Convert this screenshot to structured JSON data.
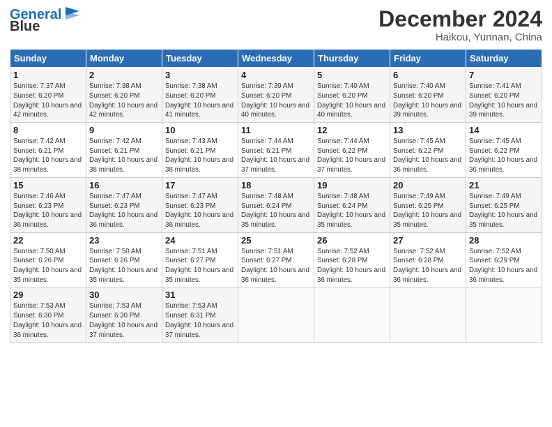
{
  "header": {
    "logo_blue": "General",
    "logo_black": "Blue",
    "month": "December 2024",
    "location": "Haikou, Yunnan, China"
  },
  "days_of_week": [
    "Sunday",
    "Monday",
    "Tuesday",
    "Wednesday",
    "Thursday",
    "Friday",
    "Saturday"
  ],
  "weeks": [
    [
      {
        "day": "1",
        "sunrise": "Sunrise: 7:37 AM",
        "sunset": "Sunset: 6:20 PM",
        "daylight": "Daylight: 10 hours and 42 minutes."
      },
      {
        "day": "2",
        "sunrise": "Sunrise: 7:38 AM",
        "sunset": "Sunset: 6:20 PM",
        "daylight": "Daylight: 10 hours and 42 minutes."
      },
      {
        "day": "3",
        "sunrise": "Sunrise: 7:38 AM",
        "sunset": "Sunset: 6:20 PM",
        "daylight": "Daylight: 10 hours and 41 minutes."
      },
      {
        "day": "4",
        "sunrise": "Sunrise: 7:39 AM",
        "sunset": "Sunset: 6:20 PM",
        "daylight": "Daylight: 10 hours and 40 minutes."
      },
      {
        "day": "5",
        "sunrise": "Sunrise: 7:40 AM",
        "sunset": "Sunset: 6:20 PM",
        "daylight": "Daylight: 10 hours and 40 minutes."
      },
      {
        "day": "6",
        "sunrise": "Sunrise: 7:40 AM",
        "sunset": "Sunset: 6:20 PM",
        "daylight": "Daylight: 10 hours and 39 minutes."
      },
      {
        "day": "7",
        "sunrise": "Sunrise: 7:41 AM",
        "sunset": "Sunset: 6:20 PM",
        "daylight": "Daylight: 10 hours and 39 minutes."
      }
    ],
    [
      {
        "day": "8",
        "sunrise": "Sunrise: 7:42 AM",
        "sunset": "Sunset: 6:21 PM",
        "daylight": "Daylight: 10 hours and 38 minutes."
      },
      {
        "day": "9",
        "sunrise": "Sunrise: 7:42 AM",
        "sunset": "Sunset: 6:21 PM",
        "daylight": "Daylight: 10 hours and 38 minutes."
      },
      {
        "day": "10",
        "sunrise": "Sunrise: 7:43 AM",
        "sunset": "Sunset: 6:21 PM",
        "daylight": "Daylight: 10 hours and 38 minutes."
      },
      {
        "day": "11",
        "sunrise": "Sunrise: 7:44 AM",
        "sunset": "Sunset: 6:21 PM",
        "daylight": "Daylight: 10 hours and 37 minutes."
      },
      {
        "day": "12",
        "sunrise": "Sunrise: 7:44 AM",
        "sunset": "Sunset: 6:22 PM",
        "daylight": "Daylight: 10 hours and 37 minutes."
      },
      {
        "day": "13",
        "sunrise": "Sunrise: 7:45 AM",
        "sunset": "Sunset: 6:22 PM",
        "daylight": "Daylight: 10 hours and 36 minutes."
      },
      {
        "day": "14",
        "sunrise": "Sunrise: 7:45 AM",
        "sunset": "Sunset: 6:22 PM",
        "daylight": "Daylight: 10 hours and 36 minutes."
      }
    ],
    [
      {
        "day": "15",
        "sunrise": "Sunrise: 7:46 AM",
        "sunset": "Sunset: 6:23 PM",
        "daylight": "Daylight: 10 hours and 36 minutes."
      },
      {
        "day": "16",
        "sunrise": "Sunrise: 7:47 AM",
        "sunset": "Sunset: 6:23 PM",
        "daylight": "Daylight: 10 hours and 36 minutes."
      },
      {
        "day": "17",
        "sunrise": "Sunrise: 7:47 AM",
        "sunset": "Sunset: 6:23 PM",
        "daylight": "Daylight: 10 hours and 36 minutes."
      },
      {
        "day": "18",
        "sunrise": "Sunrise: 7:48 AM",
        "sunset": "Sunset: 6:24 PM",
        "daylight": "Daylight: 10 hours and 35 minutes."
      },
      {
        "day": "19",
        "sunrise": "Sunrise: 7:48 AM",
        "sunset": "Sunset: 6:24 PM",
        "daylight": "Daylight: 10 hours and 35 minutes."
      },
      {
        "day": "20",
        "sunrise": "Sunrise: 7:49 AM",
        "sunset": "Sunset: 6:25 PM",
        "daylight": "Daylight: 10 hours and 35 minutes."
      },
      {
        "day": "21",
        "sunrise": "Sunrise: 7:49 AM",
        "sunset": "Sunset: 6:25 PM",
        "daylight": "Daylight: 10 hours and 35 minutes."
      }
    ],
    [
      {
        "day": "22",
        "sunrise": "Sunrise: 7:50 AM",
        "sunset": "Sunset: 6:26 PM",
        "daylight": "Daylight: 10 hours and 35 minutes."
      },
      {
        "day": "23",
        "sunrise": "Sunrise: 7:50 AM",
        "sunset": "Sunset: 6:26 PM",
        "daylight": "Daylight: 10 hours and 35 minutes."
      },
      {
        "day": "24",
        "sunrise": "Sunrise: 7:51 AM",
        "sunset": "Sunset: 6:27 PM",
        "daylight": "Daylight: 10 hours and 35 minutes."
      },
      {
        "day": "25",
        "sunrise": "Sunrise: 7:51 AM",
        "sunset": "Sunset: 6:27 PM",
        "daylight": "Daylight: 10 hours and 36 minutes."
      },
      {
        "day": "26",
        "sunrise": "Sunrise: 7:52 AM",
        "sunset": "Sunset: 6:28 PM",
        "daylight": "Daylight: 10 hours and 36 minutes."
      },
      {
        "day": "27",
        "sunrise": "Sunrise: 7:52 AM",
        "sunset": "Sunset: 6:28 PM",
        "daylight": "Daylight: 10 hours and 36 minutes."
      },
      {
        "day": "28",
        "sunrise": "Sunrise: 7:52 AM",
        "sunset": "Sunset: 6:29 PM",
        "daylight": "Daylight: 10 hours and 36 minutes."
      }
    ],
    [
      {
        "day": "29",
        "sunrise": "Sunrise: 7:53 AM",
        "sunset": "Sunset: 6:30 PM",
        "daylight": "Daylight: 10 hours and 36 minutes."
      },
      {
        "day": "30",
        "sunrise": "Sunrise: 7:53 AM",
        "sunset": "Sunset: 6:30 PM",
        "daylight": "Daylight: 10 hours and 37 minutes."
      },
      {
        "day": "31",
        "sunrise": "Sunrise: 7:53 AM",
        "sunset": "Sunset: 6:31 PM",
        "daylight": "Daylight: 10 hours and 37 minutes."
      },
      null,
      null,
      null,
      null
    ]
  ]
}
